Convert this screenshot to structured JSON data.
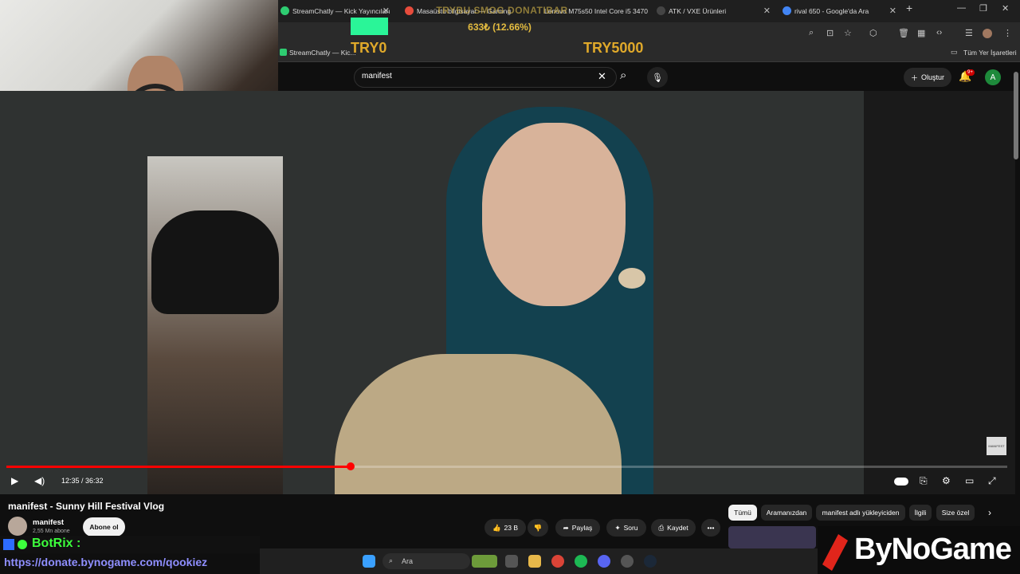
{
  "browser": {
    "tabs": [
      {
        "label": "StreamChatly — Kick Yayıncıları",
        "color": "#2ecc71"
      },
      {
        "label": "Masaüstü bilgisayar — Gaming",
        "color": "#e74c3c"
      },
      {
        "label": "Lenovo M75s50 Intel Core i5 3470",
        "color": "#888888"
      },
      {
        "label": "ATK / VXE Ürünleri",
        "color": "#333333"
      },
      {
        "label": "rival 650 - Google'da Ara",
        "color": "#4285f4"
      }
    ],
    "new_tab": "+",
    "bookmark": "StreamChatly — Kic...",
    "all_bookmarks": "Tüm Yer İşaretleri"
  },
  "donation_goal": {
    "title": "TRYBU SMOG DONATIBAR",
    "amount": "633₺ (12.66%)",
    "min": "TRY0",
    "max": "TRY5000",
    "progress_fraction": 0.1266
  },
  "youtube": {
    "search_value": "manifest",
    "create_label": "Oluştur",
    "badge": "9+",
    "avatar_letter": "A",
    "time": "12:35 / 36:32",
    "progress_fraction": 0.344,
    "video_title": "manifest - Sunny Hill Festival Vlog",
    "channel_name": "manifest",
    "subscribers": "2,55 Mn abone",
    "subscribe_label": "Abone ol",
    "likes": "23 B",
    "share_label": "Paylaş",
    "ask_label": "Soru",
    "save_label": "Kaydet",
    "more_label": "•••",
    "corner_logo": "MANIFEST",
    "chips": [
      "Tümü",
      "Aramanızdan",
      "manifest adlı yükleyiciden",
      "İlgili",
      "Size özel"
    ]
  },
  "overlay": {
    "botrix": "BotRix :",
    "donate_link": "https://donate.bynogame.com/qookiez",
    "bynogame": "ByNoGame"
  },
  "taskbar": {
    "search_label": "Ara"
  }
}
